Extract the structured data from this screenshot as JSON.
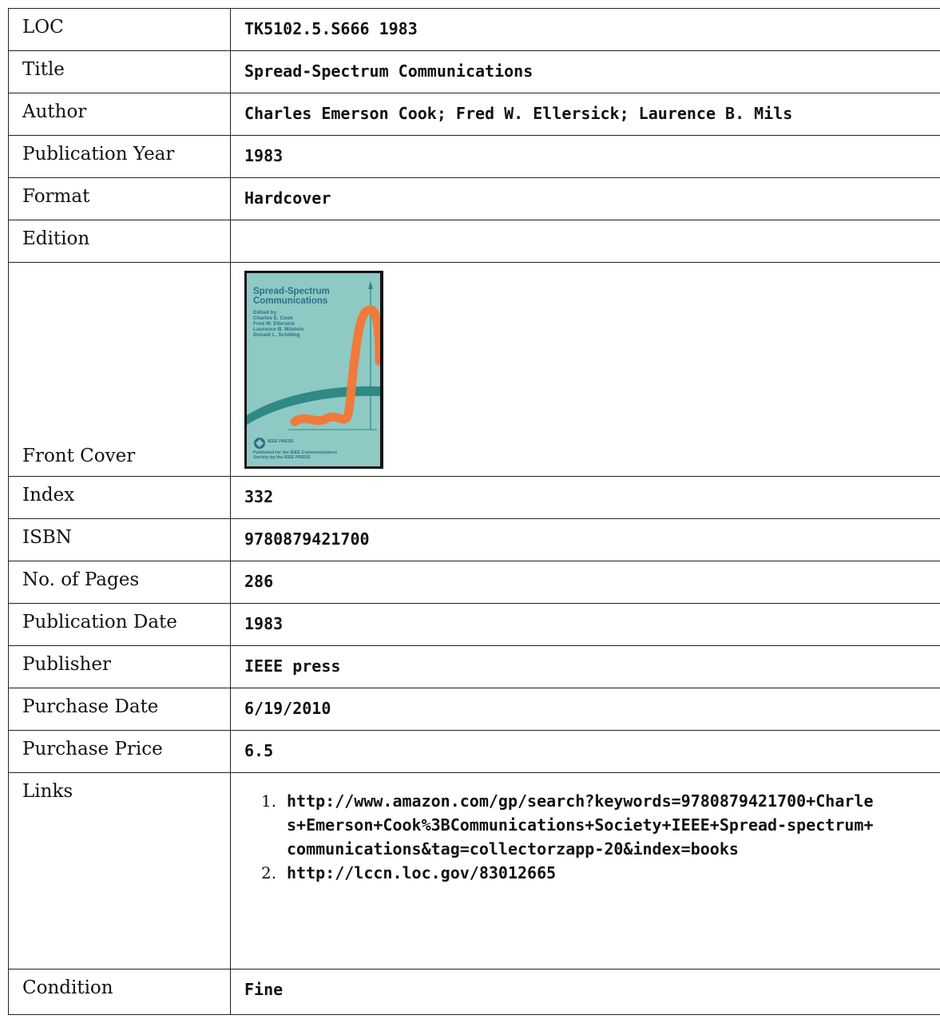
{
  "rows": [
    {
      "label": "LOC",
      "value": "TK5102.5.S666 1983"
    },
    {
      "label": "Title",
      "value": "Spread-Spectrum Communications"
    },
    {
      "label": "Author",
      "value": "Charles Emerson Cook; Fred W. Ellersick; Laurence B. Mils"
    },
    {
      "label": "Publication Year",
      "value": "1983"
    },
    {
      "label": "Format",
      "value": "Hardcover"
    },
    {
      "label": "Edition",
      "value": ""
    }
  ],
  "cover": {
    "label": "Front Cover",
    "book_title_line1": "Spread-Spectrum",
    "book_title_line2": "Communications",
    "edited_by": "Edited by",
    "editor1": "Charles E. Cook",
    "editor2": "Fred W. Ellersick",
    "editor3": "Laurence B. Milstein",
    "editor4": "Donald L. Schilling",
    "press_logo_text": "IEEE PRESS",
    "published_line1": "Published for the IEEE Communications",
    "published_line2": "Society by the IEEE PRESS",
    "colors": {
      "background": "#8fc9c3",
      "title": "#2a6f88",
      "band": "#2f8a85",
      "curve": "#f07a3c"
    }
  },
  "rows2": [
    {
      "label": "Index",
      "value": "332"
    },
    {
      "label": "ISBN",
      "value": "9780879421700"
    },
    {
      "label": "No. of Pages",
      "value": "286"
    },
    {
      "label": "Publication Date",
      "value": "1983"
    },
    {
      "label": "Publisher",
      "value": "IEEE press"
    },
    {
      "label": "Purchase Date",
      "value": "6/19/2010"
    },
    {
      "label": "Purchase Price",
      "value": "6.5"
    }
  ],
  "links": {
    "label": "Links",
    "items": [
      {
        "num": "1.",
        "url": "http://www.amazon.com/gp/search?keywords=9780879421700+Charles+Emerson+Cook%3BCommunications+Society+IEEE+Spread-spectrum+communications&tag=collectorzapp-20&index=books"
      },
      {
        "num": "2.",
        "url": "http://lccn.loc.gov/83012665"
      }
    ]
  },
  "condition": {
    "label": "Condition",
    "value": "Fine"
  }
}
